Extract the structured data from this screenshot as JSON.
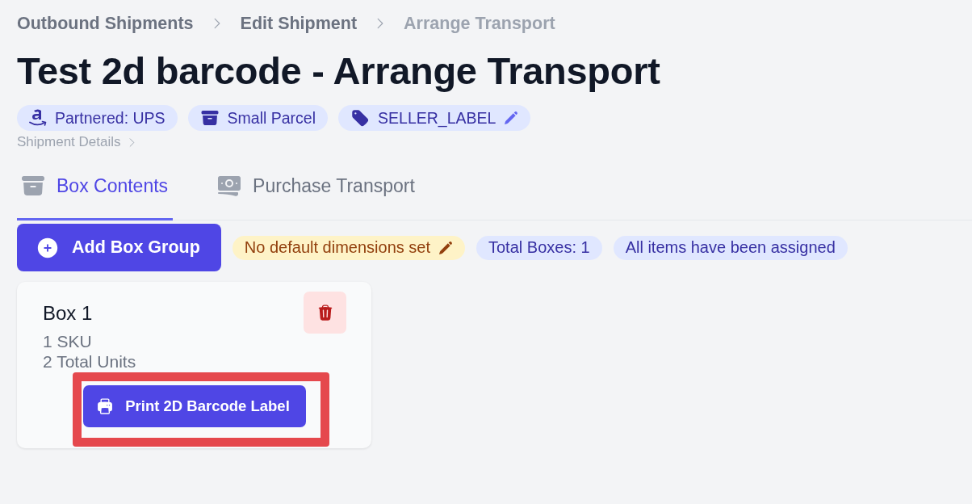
{
  "breadcrumb": [
    {
      "label": "Outbound Shipments",
      "current": false
    },
    {
      "label": "Edit Shipment",
      "current": false
    },
    {
      "label": "Arrange Transport",
      "current": true
    }
  ],
  "title": "Test 2d barcode - Arrange Transport",
  "badges": [
    {
      "label": "Partnered: UPS",
      "kind": "carrier",
      "editable": false
    },
    {
      "label": "Small Parcel",
      "kind": "mode",
      "editable": false
    },
    {
      "label": "SELLER_LABEL",
      "kind": "label",
      "editable": true
    }
  ],
  "details_link": "Shipment Details",
  "tabs": [
    {
      "label": "Box Contents",
      "kind": "box",
      "selected": true
    },
    {
      "label": "Purchase Transport",
      "kind": "money",
      "selected": false
    }
  ],
  "toolbar": {
    "add_button": "Add Box Group",
    "badges": [
      {
        "label": "No default dimensions set",
        "kind": "warning",
        "editable": true
      },
      {
        "label": "Total Boxes: 1",
        "kind": "info",
        "editable": false
      },
      {
        "label": "All items have been assigned",
        "kind": "info",
        "editable": false
      }
    ]
  },
  "boxes": [
    {
      "name": "Box 1",
      "lines": [
        "1 SKU",
        "2 Total Units"
      ],
      "print_button": {
        "label": "Print 2D Barcode Label",
        "highlighted": true
      }
    }
  ]
}
